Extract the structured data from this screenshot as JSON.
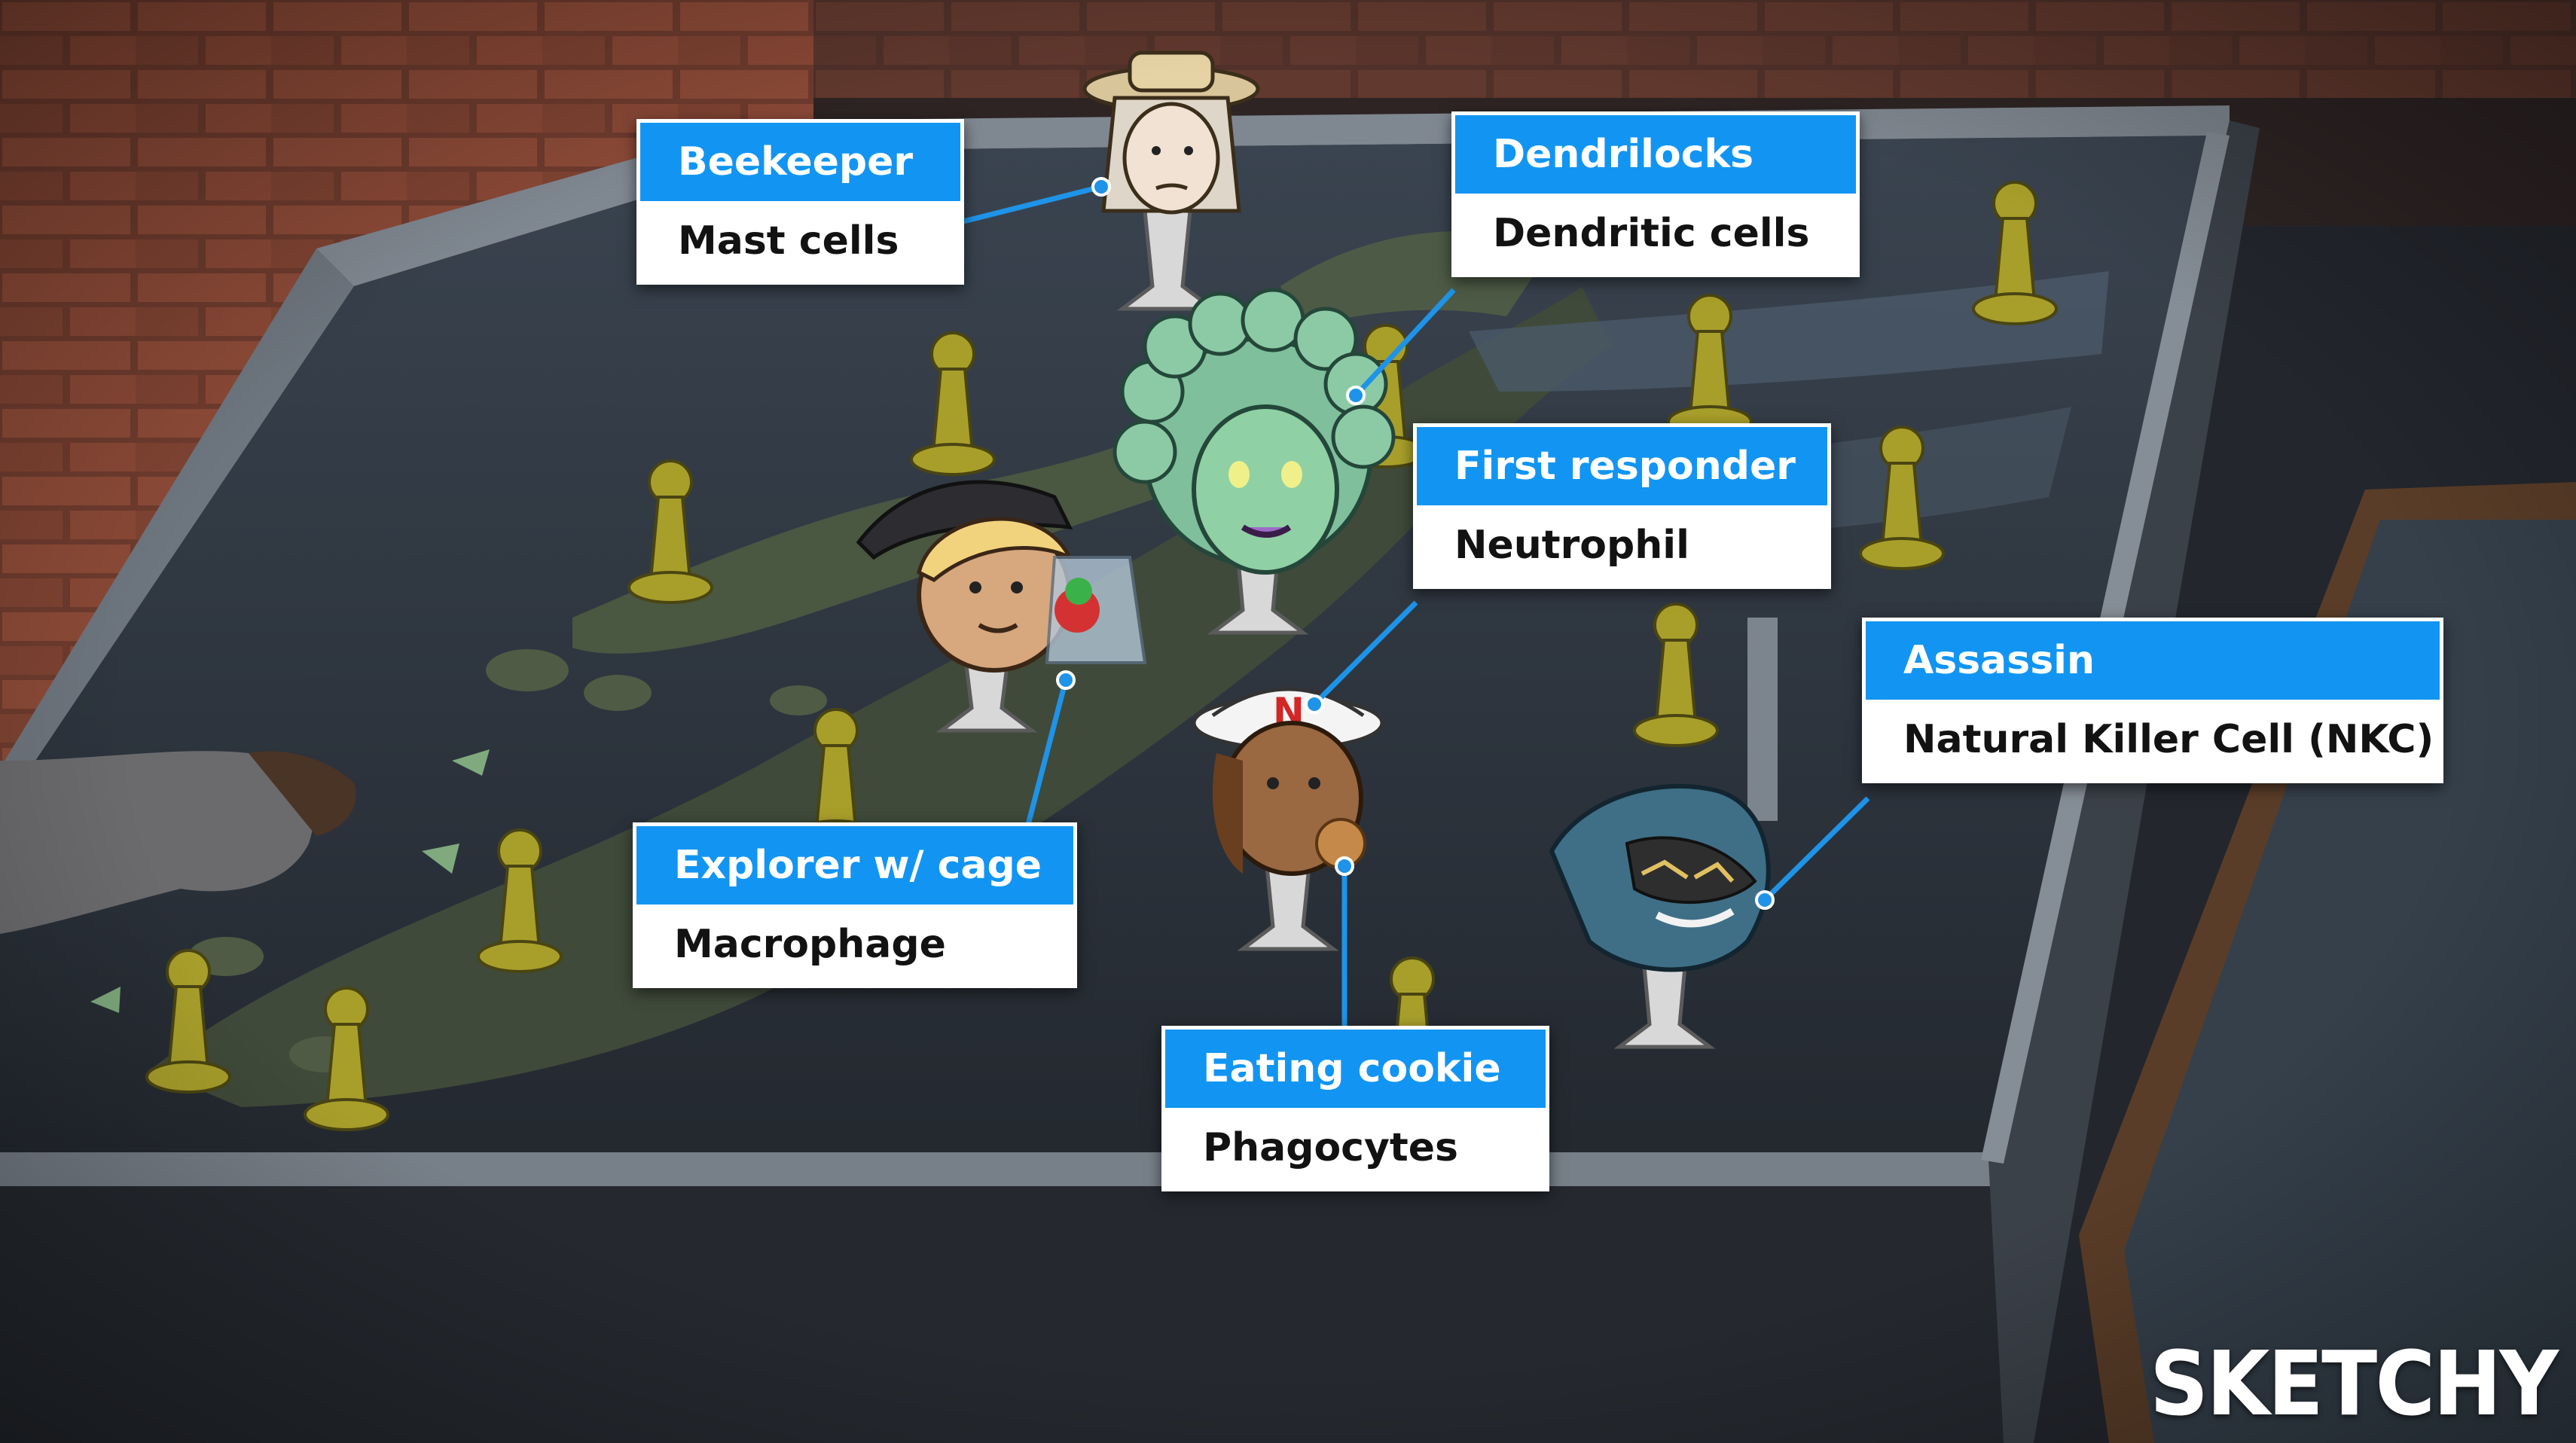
{
  "callouts": {
    "beekeeper": {
      "title": "Beekeeper",
      "subtitle": "Mast cells"
    },
    "dendrilocks": {
      "title": "Dendrilocks",
      "subtitle": "Dendritic cells"
    },
    "first_responder": {
      "title": "First responder",
      "subtitle": "Neutrophil"
    },
    "assassin": {
      "title": "Assassin",
      "subtitle": "Natural Killer Cell (NKC)"
    },
    "explorer": {
      "title": "Explorer w/ cage",
      "subtitle": "Macrophage"
    },
    "eating_cookie": {
      "title": "Eating cookie",
      "subtitle": "Phagocytes"
    }
  },
  "hat_letter": "N",
  "logo": "SKETCHY",
  "colors": {
    "callout_header": "#1295f2",
    "callout_body": "#ffffff",
    "brick": "#8a4a38",
    "table": "#2a2e35",
    "pawn": "#a9a12c"
  }
}
